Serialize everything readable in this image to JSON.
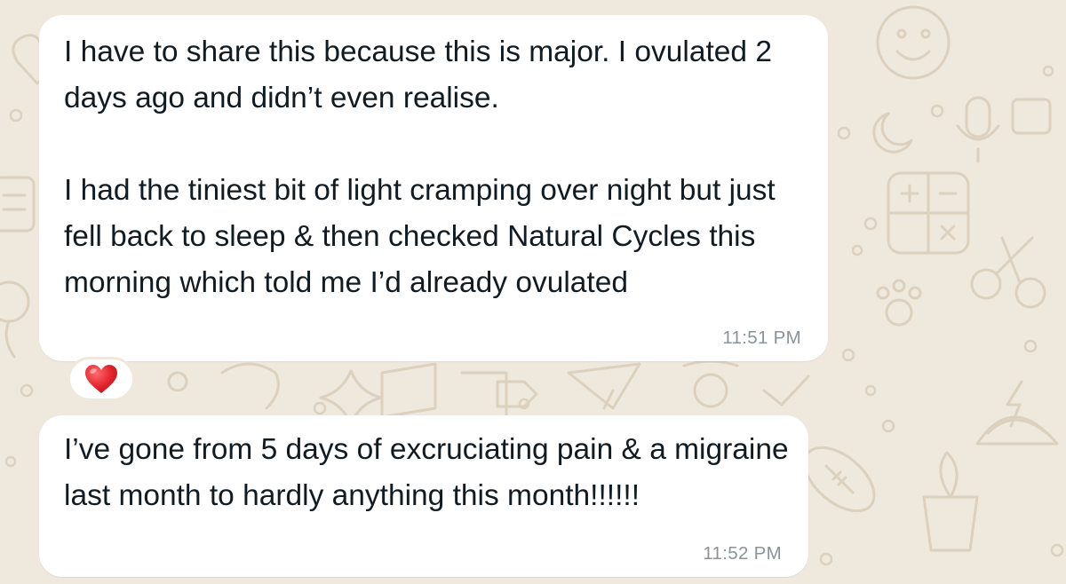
{
  "messages": [
    {
      "text": "I have to share this because this is major. I ovulated 2 days ago and didn’t even realise.\n\nI had the tiniest bit of light cramping over night but just fell back to sleep & then checked Natural Cycles this morning which told me I’d already ovulated",
      "time": "11:51 PM",
      "reaction": "heart-icon"
    },
    {
      "text": "I’ve gone from 5 days of excruciating pain & a migraine last month to hardly anything this month!!!!!!",
      "time": "11:52 PM"
    }
  ],
  "colors": {
    "wallpaper": "#efe8dd",
    "wallpaper_doodle": "#dcd2c3",
    "bubble": "#ffffff",
    "text": "#111b21",
    "timestamp": "#8a9399",
    "heart": "#e0202a"
  }
}
